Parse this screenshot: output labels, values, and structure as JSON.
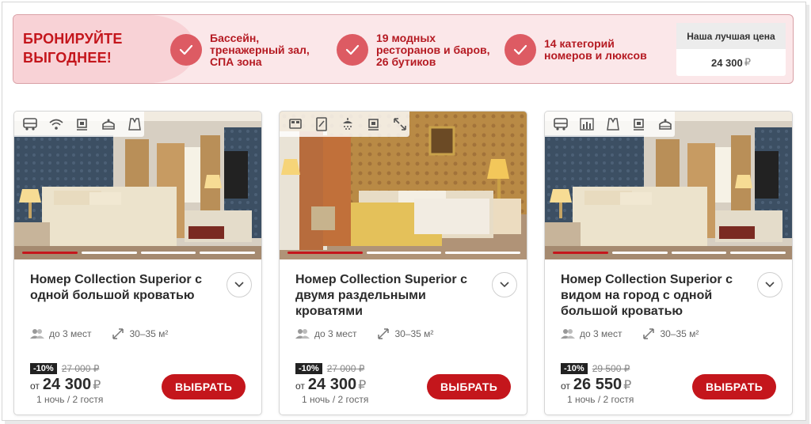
{
  "banner": {
    "title": "БРОНИРУЙТЕ ВЫГОДНЕЕ!",
    "features": [
      {
        "text": "Бассейн, тренажерный зал, СПА зона"
      },
      {
        "text": "19 модных ресторанов и баров, 26 бутиков"
      },
      {
        "text": "14 категорий номеров и люксов"
      }
    ],
    "best_price_label": "Наша лучшая цена",
    "best_price_value": "24 300",
    "currency": "₽"
  },
  "rooms": [
    {
      "title": "Номер Collection Superior с одной большой кроватью",
      "amenities": [
        "bus-icon",
        "wifi-icon",
        "coffee-icon",
        "spa-icon",
        "bathrobe-icon"
      ],
      "guests": "до 3 мест",
      "area": "30–35 м²",
      "discount": "-10%",
      "old_price": "27 000 ₽",
      "from": "от",
      "price": "24 300",
      "currency": "₽",
      "nights": "1 ночь / 2 гостя",
      "button": "ВЫБРАТЬ",
      "active_slide": 1,
      "slides": 4
    },
    {
      "title": "Номер Collection Superior с двумя раздельными кроватями",
      "amenities": [
        "bed-icon",
        "tablet-icon",
        "shower-icon",
        "coffee-icon",
        "expand-icon"
      ],
      "guests": "до 3 мест",
      "area": "30–35 м²",
      "discount": "-10%",
      "old_price": "27 000 ₽",
      "from": "от",
      "price": "24 300",
      "currency": "₽",
      "nights": "1 ночь / 2 гостя",
      "button": "ВЫБРАТЬ",
      "active_slide": 1,
      "slides": 3
    },
    {
      "title": "Номер Collection Superior с видом на город с одной большой кроватью",
      "amenities": [
        "bus-icon",
        "city-view-icon",
        "bathrobe-icon",
        "coffee-icon",
        "spa-icon"
      ],
      "guests": "до 3 мест",
      "area": "30–35 м²",
      "discount": "-10%",
      "old_price": "29 500 ₽",
      "from": "от",
      "price": "26 550",
      "currency": "₽",
      "nights": "1 ночь / 2 гостя",
      "button": "ВЫБРАТЬ",
      "active_slide": 1,
      "slides": 4
    }
  ],
  "colors": {
    "accent": "#c4161c",
    "banner_bg": "#fbe7e9",
    "check_bg": "#dd5b63"
  }
}
